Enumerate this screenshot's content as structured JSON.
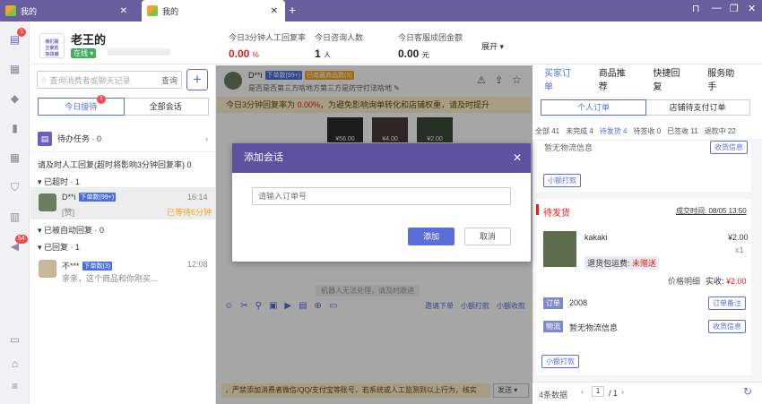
{
  "tabs": [
    {
      "label": "我的"
    },
    {
      "label": "我的"
    }
  ],
  "header": {
    "username": "老王的",
    "status": "在线",
    "shop_icon_text": "我们是\n王家的\n杂货铺",
    "stats": [
      {
        "label": "今日3分钟人工回复率",
        "value": "0.00",
        "unit": "%",
        "color": "#e02020"
      },
      {
        "label": "今日咨询人数",
        "value": "1",
        "unit": "人",
        "color": "#222"
      },
      {
        "label": "今日客服成团金额",
        "value": "0.00",
        "unit": "元",
        "color": "#222"
      }
    ],
    "expand_label": "展开"
  },
  "sidebar": {
    "msg_badge": "1",
    "vol_badge": "54"
  },
  "left": {
    "search_placeholder": "查询消费者或聊天记录",
    "search_btn": "查询",
    "tab_today": "今日接待",
    "tab_today_badge": "1",
    "tab_all": "全部会话",
    "todo_label": "待办任务 · 0",
    "note": "请及时人工回复(超时将影响3分钟回复率) 0",
    "sec_timeout": "已超时 · 1",
    "conv1": {
      "name": "D**i",
      "badge": "下单数(99+)",
      "time": "16:14",
      "msg": "[赞]",
      "wait": "已等待6分钟"
    },
    "sec_auto": "已被自动回复 · 0",
    "sec_replied": "已回复 · 1",
    "conv2": {
      "name": "不***",
      "badge": "下单数(3)",
      "time": "12:08",
      "msg": "亲亲，这个商品和你刚买..."
    }
  },
  "chat": {
    "name": "D**i",
    "badge_orders": "下单数(99+)",
    "badge_fav": "已收藏商品数(5)",
    "subline": "是否是否第三方啥地方第三方是防守打法啥地",
    "alert_pre": "今日3分钟回复率为 ",
    "alert_val": "0.00%",
    "alert_post": "，为避免影响询单转化和店铺权重，请及时提升",
    "prices": [
      "¥56.00",
      "¥4.00",
      "¥2.00"
    ],
    "robot_note": "机器人无法处理，请及时跟进",
    "tool_links": [
      "邀请下单",
      "小额打款",
      "小额收款"
    ],
    "notice": "，严禁添加消费者微信/QQ/支付宝等账号，若系统或人工监测到以上行为，核实",
    "send": "发送"
  },
  "modal": {
    "title": "添加会话",
    "placeholder": "请输入订单号",
    "ok": "添加",
    "cancel": "取消"
  },
  "right": {
    "tabs": [
      "买家订单",
      "商品推荐",
      "快捷回复",
      "服务助手"
    ],
    "sub": [
      "个人订单",
      "店铺待支付订单"
    ],
    "counts": [
      "全部 41",
      "未完成 4",
      "待发货 4",
      "待签收 0",
      "已签收 11",
      "退款中 22"
    ],
    "card1": {
      "logi_text": "暂无物流信息",
      "logi_btn": "收货信息",
      "pay_btn": "小额打款"
    },
    "card2": {
      "status": "待发货",
      "time_label": "成交时间: 08/05 13:50",
      "item": "kakaki",
      "price": "¥2.00",
      "qty": "x1",
      "freight": "退货包运费:",
      "freight_val": "未赠送",
      "price_detail": "价格明细",
      "paid_label": "实收:",
      "paid": "¥2.00",
      "order_tag": "订单",
      "order_no": "2008",
      "order_btn": "订单备注",
      "logi_tag": "物流",
      "logi_text": "暂无物流信息",
      "logi_btn": "收货信息",
      "pay_btn": "小额打款"
    },
    "footer": {
      "total": "4条数据",
      "page": "1",
      "pages": "/ 1"
    }
  }
}
